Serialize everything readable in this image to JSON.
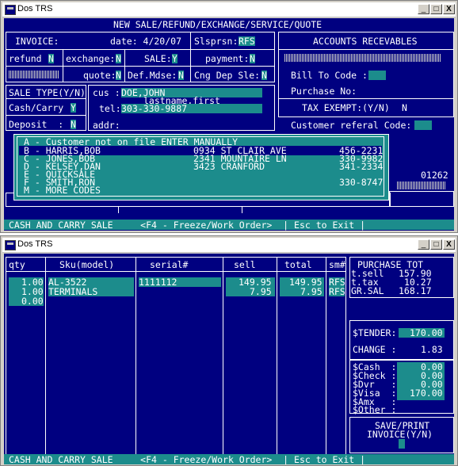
{
  "top_window": {
    "title": "Dos TRS",
    "controls": [
      "_",
      "□",
      "X"
    ],
    "header": "NEW SALE/REFUND/EXCHANGE/SERVICE/QUOTE",
    "invoice_label": "INVOICE:",
    "date_label": "date: 4/20/07",
    "slsprsn_label": "Slsprsn:",
    "slsprsn_value": "RFS",
    "refund_label": "refund",
    "refund_value": "N",
    "exchange_label": "exchange:",
    "exchange_value": "N",
    "sale_label": "SALE:",
    "sale_value": "Y",
    "payment_label": "payment:",
    "payment_value": "N",
    "quote_label": "quote:",
    "quote_value": "N",
    "def_mdse_label": "Def.Mdse:",
    "def_mdse_value": "N",
    "cng_dep_label": "Cng Dep Sle:",
    "cng_dep_value": "N",
    "accounts_header": "ACCOUNTS RECEVABLES",
    "bill_to_label": "Bill To Code :",
    "purchase_no_label": "Purchase No:",
    "sale_type_label": "SALE TYPE(Y/N)",
    "cash_carry_label": "Cash/Carry",
    "cash_carry_value": "Y",
    "deposit_label": "Deposit  :",
    "deposit_value": "N",
    "cus_label": "cus :",
    "cus_value": "DOE,JOHN",
    "cus_hint": "lastname,first",
    "tel_label": "tel:",
    "tel_value": "303-330-9887",
    "addr_label": "addr:",
    "tax_exempt_label": "TAX EXEMPT:(Y/N)",
    "tax_exempt_value": "N",
    "customer_referal_label": "Customer referal Code:",
    "number_right": "01262",
    "popup_lines": [
      "A - Customer not on file ENTER MANUALLY",
      "B - HARRIS,BOB",
      "C - JONES,BOB",
      "D - KELSEY,DAN",
      "E - QUICKSALE",
      "F - SMITH,RON",
      "M - MORE CODES"
    ],
    "popup_addresses": [
      "",
      "0934 ST CLAIR AVE",
      "2341 MOUNTAIRE LN",
      "3423 CRANFORD",
      "",
      "",
      ""
    ],
    "popup_phones": [
      "",
      "456-2231",
      "330-9982",
      "341-2334",
      "",
      "330-8747",
      ""
    ],
    "status": "CASH AND CARRY SALE     <F4 - Freeze/Work Order>  | Esc to Exit |"
  },
  "bottom_window": {
    "title": "Dos TRS",
    "controls": [
      "_",
      "□",
      "X"
    ],
    "columns": [
      "qty",
      "Sku(model)",
      "serial#",
      "sell",
      "total",
      "sm#"
    ],
    "rows": [
      {
        "qty": "1.00",
        "sku": "AL-3522",
        "serial": "1111112",
        "sell": "149.95",
        "total": "149.95",
        "sm": "RFS"
      },
      {
        "qty": "1.00",
        "sku": "TERMINALS",
        "serial": "",
        "sell": "7.95",
        "total": "7.95",
        "sm": "RFS"
      },
      {
        "qty": "0.00",
        "sku": "",
        "serial": "",
        "sell": "",
        "total": "",
        "sm": ""
      }
    ],
    "purchase_tot_label": "PURCHASE TOT",
    "tsell_label": "t.sell",
    "tsell_value": "157.90",
    "ttax_label": "t.tax",
    "ttax_value": "10.27",
    "grsal_label": "GR.SAL",
    "grsal_value": "168.17",
    "tender_label": "$TENDER:",
    "tender_value": "170.00",
    "change_label": "CHANGE :",
    "change_value": "1.83",
    "pay_cash_label": "$Cash  :",
    "pay_cash_value": "0.00",
    "pay_check_label": "$Check :",
    "pay_check_value": "0.00",
    "pay_dvr_label": "$Dvr   :",
    "pay_dvr_value": "0.00",
    "pay_visa_label": "$Visa  :",
    "pay_visa_value": "170.00",
    "pay_amx_label": "$Amx   :",
    "pay_other_label": "$Other :",
    "save_print_label": "SAVE/PRINT",
    "invoice_yn_label": "INVOICE(Y/N)",
    "status": "CASH AND CARRY SALE     <F4 - Freeze/Work Order>  | Esc to Exit |"
  }
}
